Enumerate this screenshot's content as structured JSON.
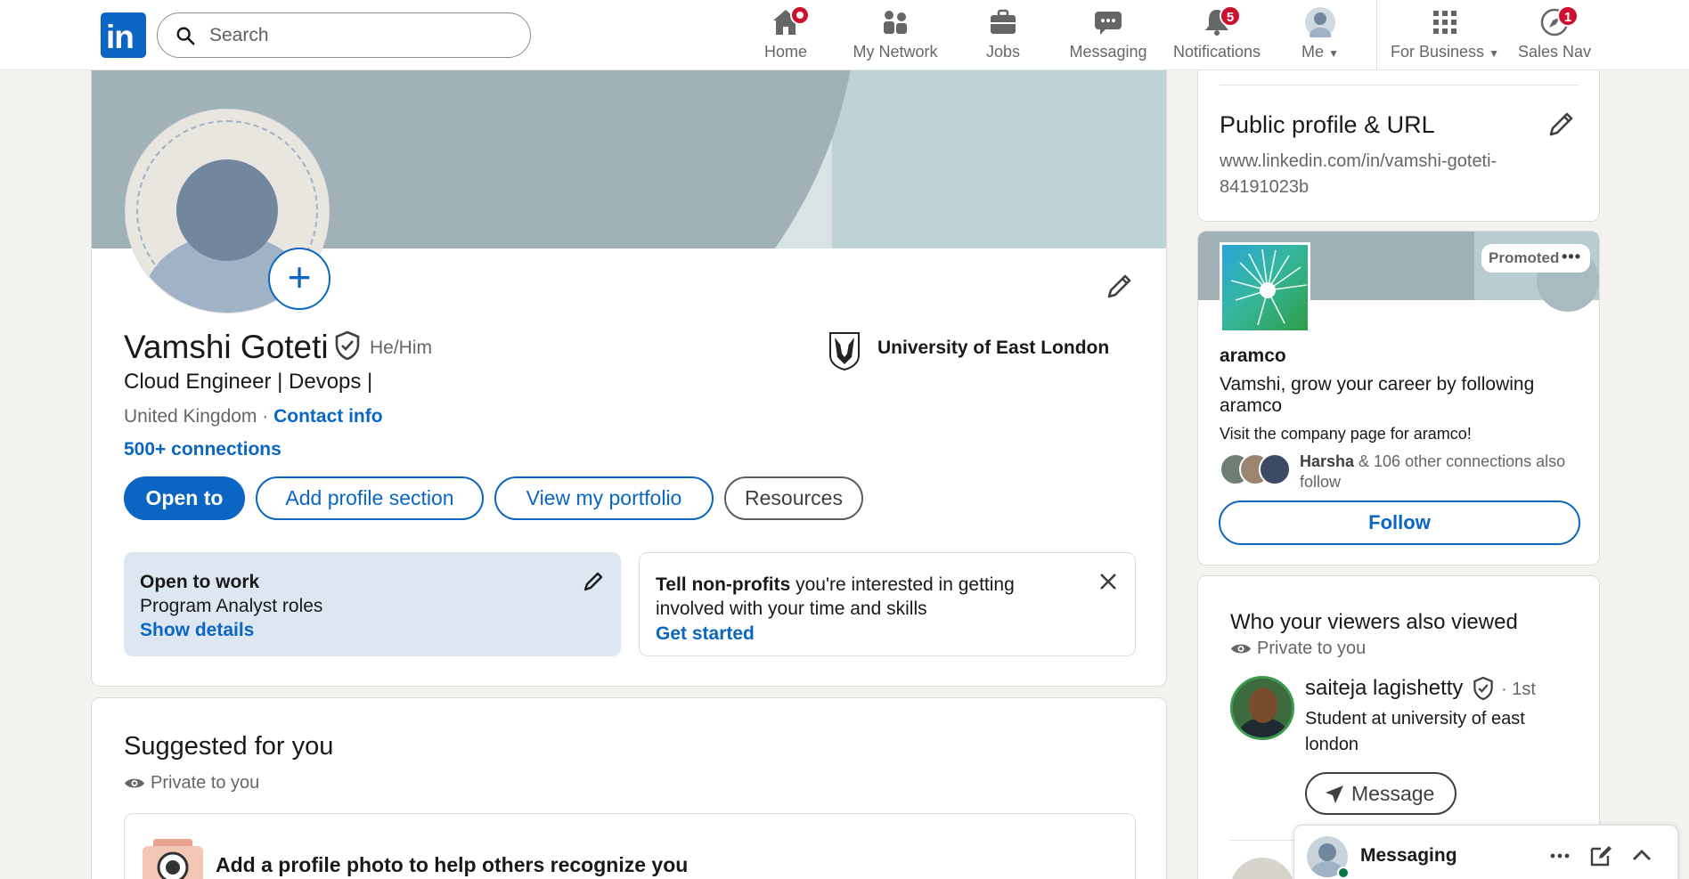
{
  "nav": {
    "search_placeholder": "Search",
    "items": [
      {
        "label": "Home",
        "badge": ""
      },
      {
        "label": "My Network",
        "badge": ""
      },
      {
        "label": "Jobs",
        "badge": ""
      },
      {
        "label": "Messaging",
        "badge": ""
      },
      {
        "label": "Notifications",
        "badge": "5"
      },
      {
        "label": "Me",
        "badge": ""
      },
      {
        "label": "For Business",
        "badge": ""
      },
      {
        "label": "Sales Nav",
        "badge": "1"
      }
    ]
  },
  "profile": {
    "name": "Vamshi Goteti",
    "pronouns": "He/Him",
    "headline": "Cloud Engineer | Devops |",
    "location": "United Kingdom ·",
    "contact_info": "Contact info",
    "connections": "500+ connections",
    "school": "University of East London",
    "buttons": {
      "open_to": "Open to",
      "add_section": "Add profile section",
      "portfolio": "View my portfolio",
      "resources": "Resources"
    },
    "open_to_work": {
      "title": "Open to work",
      "roles": "Program Analyst roles",
      "link": "Show details"
    },
    "nonprofit": {
      "bold": "Tell non-profits",
      "text": " you're interested in getting involved with your time and skills",
      "link": "Get started"
    }
  },
  "suggested": {
    "title": "Suggested for you",
    "private": "Private to you",
    "item": "Add a profile photo to help others recognize you"
  },
  "public_profile": {
    "title": "Public profile & URL",
    "url": "www.linkedin.com/in/vamshi-goteti-84191023b"
  },
  "ad": {
    "promoted": "Promoted",
    "company": "aramco",
    "line": "Vamshi, grow your career by following aramco",
    "visit": "Visit the company page for aramco!",
    "conn_name": "Harsha",
    "conn_text": " & 106 other connections also follow",
    "follow": "Follow"
  },
  "viewers": {
    "title": "Who your viewers also viewed",
    "private": "Private to you",
    "person": {
      "name": "saiteja lagishetty",
      "degree": "· 1st",
      "headline": "Student at university of east london",
      "message": "Message"
    }
  },
  "messaging": {
    "title": "Messaging"
  },
  "colors": {
    "brand": "#0a66c2",
    "badge": "#cb112d",
    "banner": "#a0b2b7"
  }
}
